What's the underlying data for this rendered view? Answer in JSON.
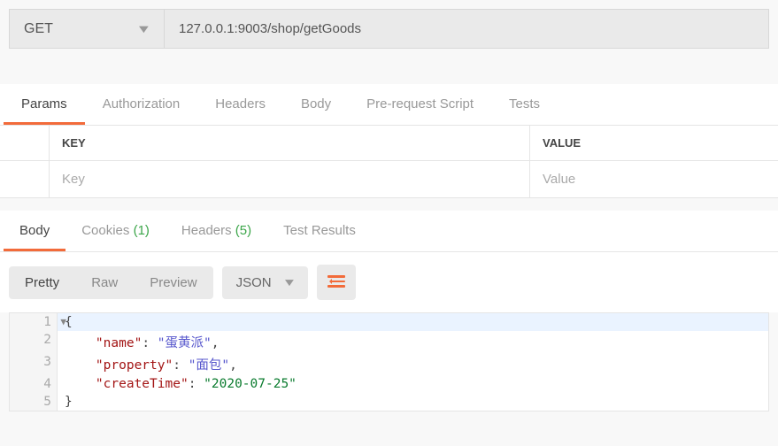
{
  "request": {
    "method": "GET",
    "url": "127.0.0.1:9003/shop/getGoods"
  },
  "tabs": {
    "params": "Params",
    "authorization": "Authorization",
    "headers": "Headers",
    "body": "Body",
    "prerequest": "Pre-request Script",
    "tests": "Tests"
  },
  "paramsTable": {
    "keyHeader": "KEY",
    "valueHeader": "VALUE",
    "keyPlaceholder": "Key",
    "valuePlaceholder": "Value"
  },
  "responseTabs": {
    "body": "Body",
    "cookies": "Cookies",
    "cookiesCount": "(1)",
    "headers": "Headers",
    "headersCount": "(5)",
    "testResults": "Test Results"
  },
  "viewer": {
    "pretty": "Pretty",
    "raw": "Raw",
    "preview": "Preview",
    "format": "JSON"
  },
  "jsonBody": {
    "line1_num": "1",
    "line1_text": "{",
    "line2_num": "2",
    "line2_key": "\"name\"",
    "line2_val": "\"蛋黄派\"",
    "line3_num": "3",
    "line3_key": "\"property\"",
    "line3_val": "\"面包\"",
    "line4_num": "4",
    "line4_key": "\"createTime\"",
    "line4_val": "\"2020-07-25\"",
    "line5_num": "5",
    "line5_text": "}"
  }
}
